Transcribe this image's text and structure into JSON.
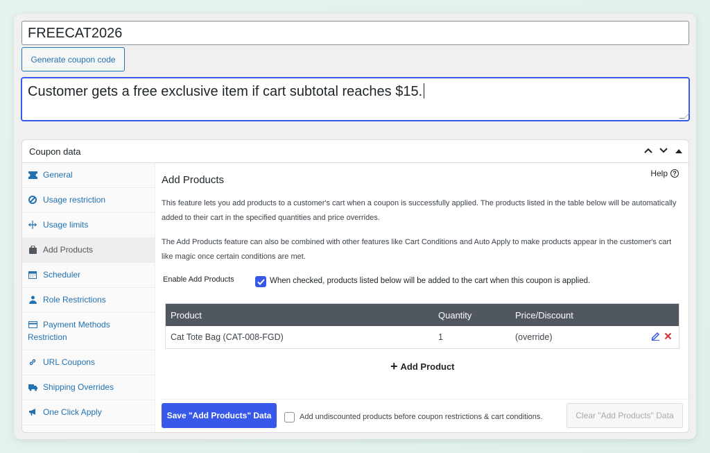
{
  "coupon": {
    "code": "FREECAT2026",
    "generate_label": "Generate coupon code",
    "description": "Customer gets a free exclusive item if cart subtotal reaches $15."
  },
  "panel": {
    "title": "Coupon data",
    "tabs": [
      {
        "label": "General",
        "icon": "ticket-icon"
      },
      {
        "label": "Usage restriction",
        "icon": "block-icon"
      },
      {
        "label": "Usage limits",
        "icon": "limits-icon"
      },
      {
        "label": "Add Products",
        "icon": "bag-icon"
      },
      {
        "label": "Scheduler",
        "icon": "calendar-icon"
      },
      {
        "label": "Role Restrictions",
        "icon": "user-icon"
      },
      {
        "label": "Payment Methods Restriction",
        "icon": "card-icon"
      },
      {
        "label": "URL Coupons",
        "icon": "link-icon"
      },
      {
        "label": "Shipping Overrides",
        "icon": "truck-icon"
      },
      {
        "label": "One Click Apply",
        "icon": "megaphone-icon"
      }
    ]
  },
  "add_products": {
    "title": "Add Products",
    "help_label": "Help",
    "para1": "This feature lets you add products to a customer's cart when a coupon is successfully applied. The products listed in the table below will be automatically added to their cart in the specified quantities and price overrides.",
    "para2": "The Add Products feature can also be combined with other features like Cart Conditions and Auto Apply to make products appear in the customer's cart like magic once certain conditions are met.",
    "enable_label": "Enable Add Products",
    "enable_checked_text": "When checked, products listed below will be added to the cart when this coupon is applied.",
    "table": {
      "headers": [
        "Product",
        "Quantity",
        "Price/Discount"
      ],
      "rows": [
        {
          "product": "Cat Tote Bag (CAT-008-FGD)",
          "quantity": "1",
          "price": "(override)"
        }
      ]
    },
    "add_product_label": "Add Product",
    "save_label": "Save \"Add Products\" Data",
    "undiscounted_label": "Add undiscounted products before coupon restrictions & cart conditions.",
    "clear_label": "Clear \"Add Products\" Data"
  },
  "colors": {
    "accent": "#3858e9",
    "link": "#2271b1",
    "table_header": "#50575e",
    "delete": "#d63638"
  }
}
